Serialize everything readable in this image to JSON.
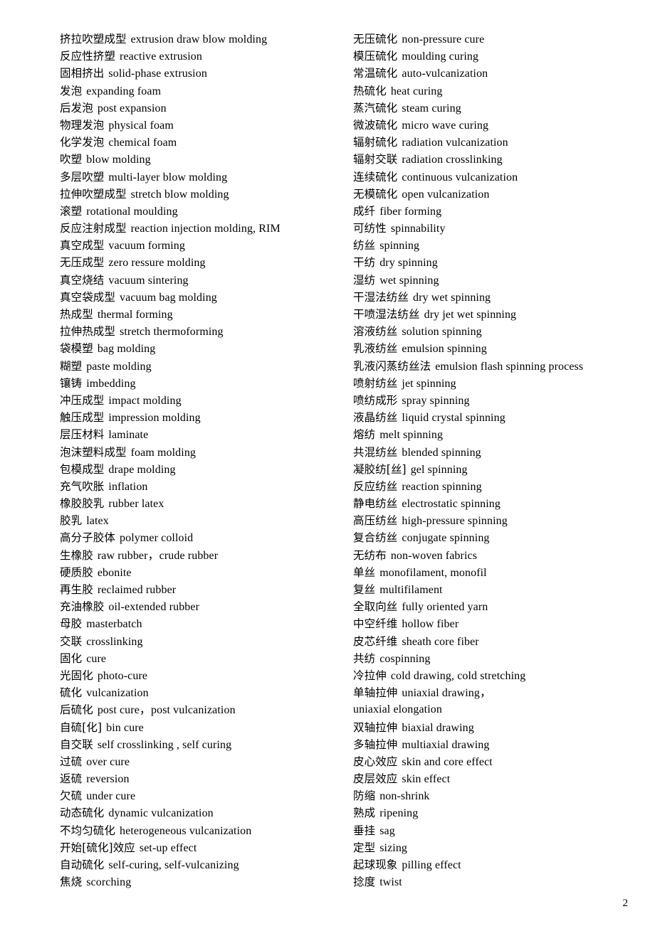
{
  "document": {
    "page_number": "2",
    "background_color": "#ffffff",
    "text_color": "#000000"
  },
  "left_column": [
    {
      "zh": "挤拉吹塑成型",
      "en": "extrusion draw blow molding"
    },
    {
      "zh": "反应性挤塑",
      "en": "reactive extrusion"
    },
    {
      "zh": "固相挤出",
      "en": "solid-phase extrusion"
    },
    {
      "zh": "发泡",
      "en": "expanding foam"
    },
    {
      "zh": "后发泡",
      "en": "post expansion"
    },
    {
      "zh": "物理发泡",
      "en": "physical foam"
    },
    {
      "zh": "化学发泡",
      "en": "chemical foam"
    },
    {
      "zh": "吹塑",
      "en": "blow molding"
    },
    {
      "zh": "多层吹塑",
      "en": "multi-layer blow molding"
    },
    {
      "zh": "拉伸吹塑成型",
      "en": "stretch blow molding"
    },
    {
      "zh": "滚塑",
      "en": "rotational moulding"
    },
    {
      "zh": "反应注射成型",
      "en": "reaction injection molding, RIM"
    },
    {
      "zh": "真空成型",
      "en": "vacuum forming"
    },
    {
      "zh": "无压成型",
      "en": "zero ressure molding"
    },
    {
      "zh": "真空烧结",
      "en": "vacuum sintering"
    },
    {
      "zh": "真空袋成型",
      "en": "vacuum bag molding"
    },
    {
      "zh": "热成型",
      "en": "thermal forming"
    },
    {
      "zh": "拉伸热成型",
      "en": "stretch thermoforming"
    },
    {
      "zh": "袋模塑",
      "en": "bag molding"
    },
    {
      "zh": "糊塑",
      "en": "paste molding"
    },
    {
      "zh": "镶铸",
      "en": "imbedding"
    },
    {
      "zh": "冲压成型",
      "en": "impact molding"
    },
    {
      "zh": "触压成型",
      "en": "impression molding"
    },
    {
      "zh": "层压材料",
      "en": "laminate"
    },
    {
      "zh": "泡沫塑料成型",
      "en": "foam molding"
    },
    {
      "zh": "包模成型",
      "en": "drape molding"
    },
    {
      "zh": "充气吹胀",
      "en": "inflation"
    },
    {
      "zh": "橡胶胶乳",
      "en": "rubber latex"
    },
    {
      "zh": "胶乳",
      "en": "latex"
    },
    {
      "zh": "高分子胶体",
      "en": "polymer colloid"
    },
    {
      "zh": "生橡胶",
      "en": "raw rubber，crude rubber"
    },
    {
      "zh": "硬质胶",
      "en": "ebonite"
    },
    {
      "zh": "再生胶",
      "en": "reclaimed rubber"
    },
    {
      "zh": "充油橡胶",
      "en": "oil-extended rubber"
    },
    {
      "zh": "母胶",
      "en": "masterbatch"
    },
    {
      "zh": "交联",
      "en": "crosslinking"
    },
    {
      "zh": "固化",
      "en": "cure"
    },
    {
      "zh": "光固化",
      "en": "photo-cure"
    },
    {
      "zh": "硫化",
      "en": "vulcanization"
    },
    {
      "zh": "后硫化",
      "en": "post cure，post vulcanization"
    },
    {
      "zh": "自硫[化]",
      "en": "bin cure"
    },
    {
      "zh": "自交联",
      "en": "self crosslinking , self curing"
    },
    {
      "zh": "过硫",
      "en": "over cure"
    },
    {
      "zh": "返硫",
      "en": "reversion"
    },
    {
      "zh": "欠硫",
      "en": "under cure"
    },
    {
      "zh": "动态硫化",
      "en": "dynamic vulcanization"
    },
    {
      "zh": "不均匀硫化",
      "en": "heterogeneous vulcanization"
    },
    {
      "zh": "开始[硫化]效应",
      "en": "set-up effect"
    },
    {
      "zh": "自动硫化",
      "en": "self-curing, self-vulcanizing"
    },
    {
      "zh": "焦烧",
      "en": "scorching"
    }
  ],
  "right_column": [
    {
      "zh": "无压硫化",
      "en": "non-pressure cure"
    },
    {
      "zh": "模压硫化",
      "en": "moulding curing"
    },
    {
      "zh": "常温硫化",
      "en": "auto-vulcanization"
    },
    {
      "zh": "热硫化",
      "en": "heat curing"
    },
    {
      "zh": "蒸汽硫化",
      "en": "steam curing"
    },
    {
      "zh": "微波硫化",
      "en": "micro wave curing"
    },
    {
      "zh": "辐射硫化",
      "en": "radiation vulcanization"
    },
    {
      "zh": "辐射交联",
      "en": "radiation crosslinking"
    },
    {
      "zh": "连续硫化",
      "en": "continuous vulcanization"
    },
    {
      "zh": "无模硫化",
      "en": "open vulcanization"
    },
    {
      "zh": "成纤",
      "en": "fiber forming"
    },
    {
      "zh": "可纺性",
      "en": "spinnability"
    },
    {
      "zh": "纺丝",
      "en": "spinning"
    },
    {
      "zh": "干纺",
      "en": "dry spinning"
    },
    {
      "zh": "湿纺",
      "en": "wet spinning"
    },
    {
      "zh": "干湿法纺丝",
      "en": "dry wet spinning"
    },
    {
      "zh": "干喷湿法纺丝",
      "en": "dry jet wet spinning"
    },
    {
      "zh": "溶液纺丝",
      "en": "solution spinning"
    },
    {
      "zh": "乳液纺丝",
      "en": "emulsion spinning"
    },
    {
      "zh": "乳液闪蒸纺丝法",
      "en": "emulsion flash spinning process"
    },
    {
      "zh": "喷射纺丝",
      "en": "jet spinning"
    },
    {
      "zh": "喷纺成形",
      "en": "spray spinning"
    },
    {
      "zh": "液晶纺丝",
      "en": "liquid crystal spinning"
    },
    {
      "zh": "熔纺",
      "en": "melt spinning"
    },
    {
      "zh": "共混纺丝",
      "en": "blended spinning"
    },
    {
      "zh": "凝胶纺[丝]",
      "en": "gel spinning"
    },
    {
      "zh": "反应纺丝",
      "en": "reaction spinning"
    },
    {
      "zh": "静电纺丝",
      "en": "electrostatic spinning"
    },
    {
      "zh": "高压纺丝",
      "en": "high-pressure spinning"
    },
    {
      "zh": "复合纺丝",
      "en": "conjugate spinning"
    },
    {
      "zh": "无纺布",
      "en": "non-woven fabrics"
    },
    {
      "zh": "单丝",
      "en": "monofilament, monofil"
    },
    {
      "zh": "复丝",
      "en": "multifilament"
    },
    {
      "zh": "全取向丝",
      "en": "fully oriented yarn"
    },
    {
      "zh": "中空纤维",
      "en": "hollow fiber"
    },
    {
      "zh": "皮芯纤维",
      "en": "sheath core fiber"
    },
    {
      "zh": "共纺",
      "en": "cospinning"
    },
    {
      "zh": "冷拉伸",
      "en": "cold drawing, cold stretching"
    },
    {
      "zh": "单轴拉伸",
      "en": "uniaxial drawing，"
    },
    {
      "zh": "",
      "en": "uniaxial elongation",
      "continuation": true
    },
    {
      "zh": "双轴拉伸",
      "en": "biaxial drawing"
    },
    {
      "zh": "多轴拉伸",
      "en": "multiaxial drawing"
    },
    {
      "zh": "皮心效应",
      "en": "skin and core effect"
    },
    {
      "zh": "皮层效应",
      "en": "skin effect"
    },
    {
      "zh": "防缩",
      "en": "non-shrink"
    },
    {
      "zh": "熟成",
      "en": "ripening"
    },
    {
      "zh": "垂挂",
      "en": "sag"
    },
    {
      "zh": "定型",
      "en": "sizing"
    },
    {
      "zh": "起球现象",
      "en": "pilling effect"
    },
    {
      "zh": "捻度",
      "en": "twist"
    }
  ]
}
